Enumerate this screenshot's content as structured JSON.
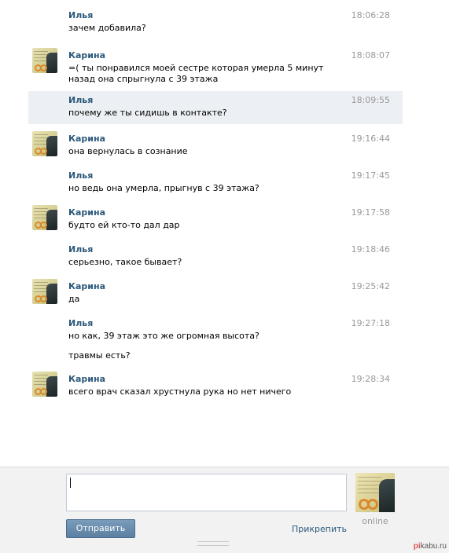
{
  "messages": [
    {
      "name": "Илья",
      "time": "18:06:28",
      "text": "зачем добавила?",
      "avatar": false
    },
    {
      "name": "Карина",
      "time": "18:08:07",
      "text": "=( ты понравился моей сестре которая умерла 5 минут назад она спрыгнула с 39 этажа",
      "avatar": true
    },
    {
      "name": "Илья",
      "time": "18:09:55",
      "text": "почему же ты сидишь в контакте?",
      "avatar": false,
      "highlighted": true
    },
    {
      "name": "Карина",
      "time": "19:16:44",
      "text": "она вернулась в сознание",
      "avatar": true
    },
    {
      "name": "Илья",
      "time": "19:17:45",
      "text": "но ведь она умерла, прыгнув с 39 этажа?",
      "avatar": false
    },
    {
      "name": "Карина",
      "time": "19:17:58",
      "text": "будто ей кто-то дал дар",
      "avatar": true
    },
    {
      "name": "Илья",
      "time": "19:18:46",
      "text": "серьезно, такое бывает?",
      "avatar": false
    },
    {
      "name": "Карина",
      "time": "19:25:42",
      "text": "да",
      "avatar": true
    },
    {
      "name": "Илья",
      "time": "19:27:18",
      "text": "но как, 39 этаж это же огромная высота?",
      "text2": "травмы есть?",
      "avatar": false
    },
    {
      "name": "Карина",
      "time": "19:28:34",
      "text": "всего врач сказал хрустнула рука но нет ничего",
      "avatar": true
    }
  ],
  "composer": {
    "value": "",
    "send_label": "Отправить",
    "attach_label": "Прикрепить",
    "status": "online"
  },
  "watermark": {
    "prefix": "pi",
    "rest": "kabu.ru"
  },
  "colors": {
    "name": "#2b587a",
    "time": "#999999",
    "highlight": "#eceff3",
    "button": "#5c7fa1"
  }
}
